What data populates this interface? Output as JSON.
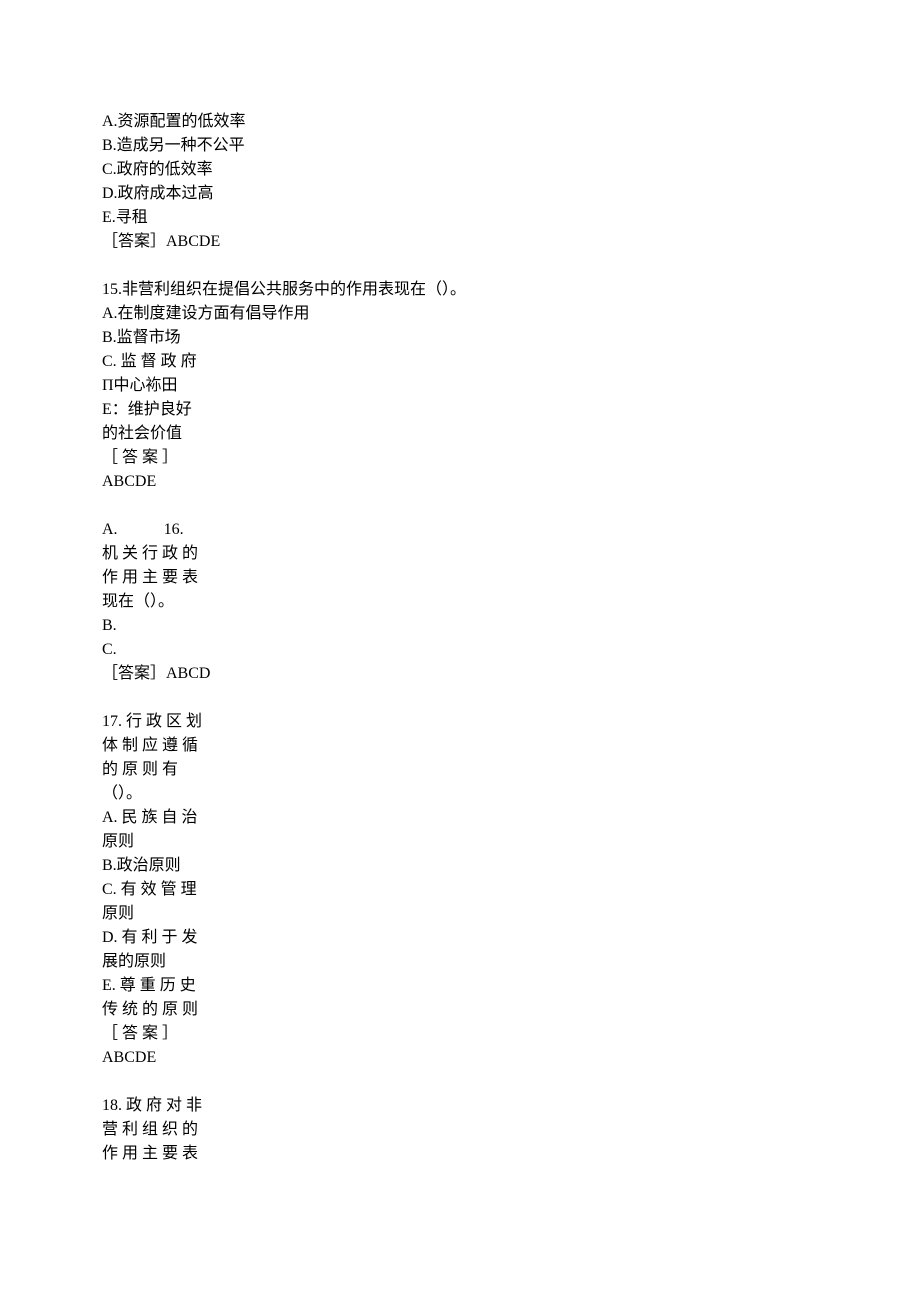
{
  "q14_tail": {
    "options": [
      "A.资源配置的低效率",
      "B.造成另一种不公平",
      "C.政府的低效率",
      "D.政府成本过高",
      "E.寻租"
    ],
    "answer": "［答案］ABCDE"
  },
  "q15": {
    "stem": "15.非营利组织在提倡公共服务中的作用表现在（）。",
    "options_wide": [
      "A.在制度建设方面有倡导作用",
      "B.监督市场"
    ],
    "opt_c": "C. 监 督 政 府",
    "garble": "Π中心袮田",
    "opt_e_l1": "E：维护良好",
    "opt_e_l2": "的社会价值",
    "ans_l1": "［ 答 案 ］",
    "ans_l2": "ABCDE"
  },
  "q16": {
    "l1_a": "A.",
    "l1_b": "16.",
    "l2": "机 关 行 政 的",
    "l3": "作 用 主 要 表",
    "l4": "现在（）。",
    "l5": "B.",
    "l6": "C.",
    "l7": "［答案］ABCD"
  },
  "q17": {
    "l1": "17. 行 政 区 划",
    "l2": "体 制 应 遵 循",
    "l3": "的 原 则 有",
    "l4": "（）。",
    "l5": "A. 民 族 自 治",
    "l6": "原则",
    "l7": "B.政治原则",
    "l8": "C. 有 效 管 理",
    "l9": "原则",
    "l10": "D. 有 利 于 发",
    "l11": "展的原则",
    "l12": "E. 尊 重 历 史",
    "l13": "传 统 的 原 则",
    "l14": "［ 答 案 ］",
    "l15": "ABCDE"
  },
  "q18": {
    "l1": "18. 政 府 对 非",
    "l2": "营 利 组 织 的",
    "l3": "作 用 主 要 表"
  }
}
